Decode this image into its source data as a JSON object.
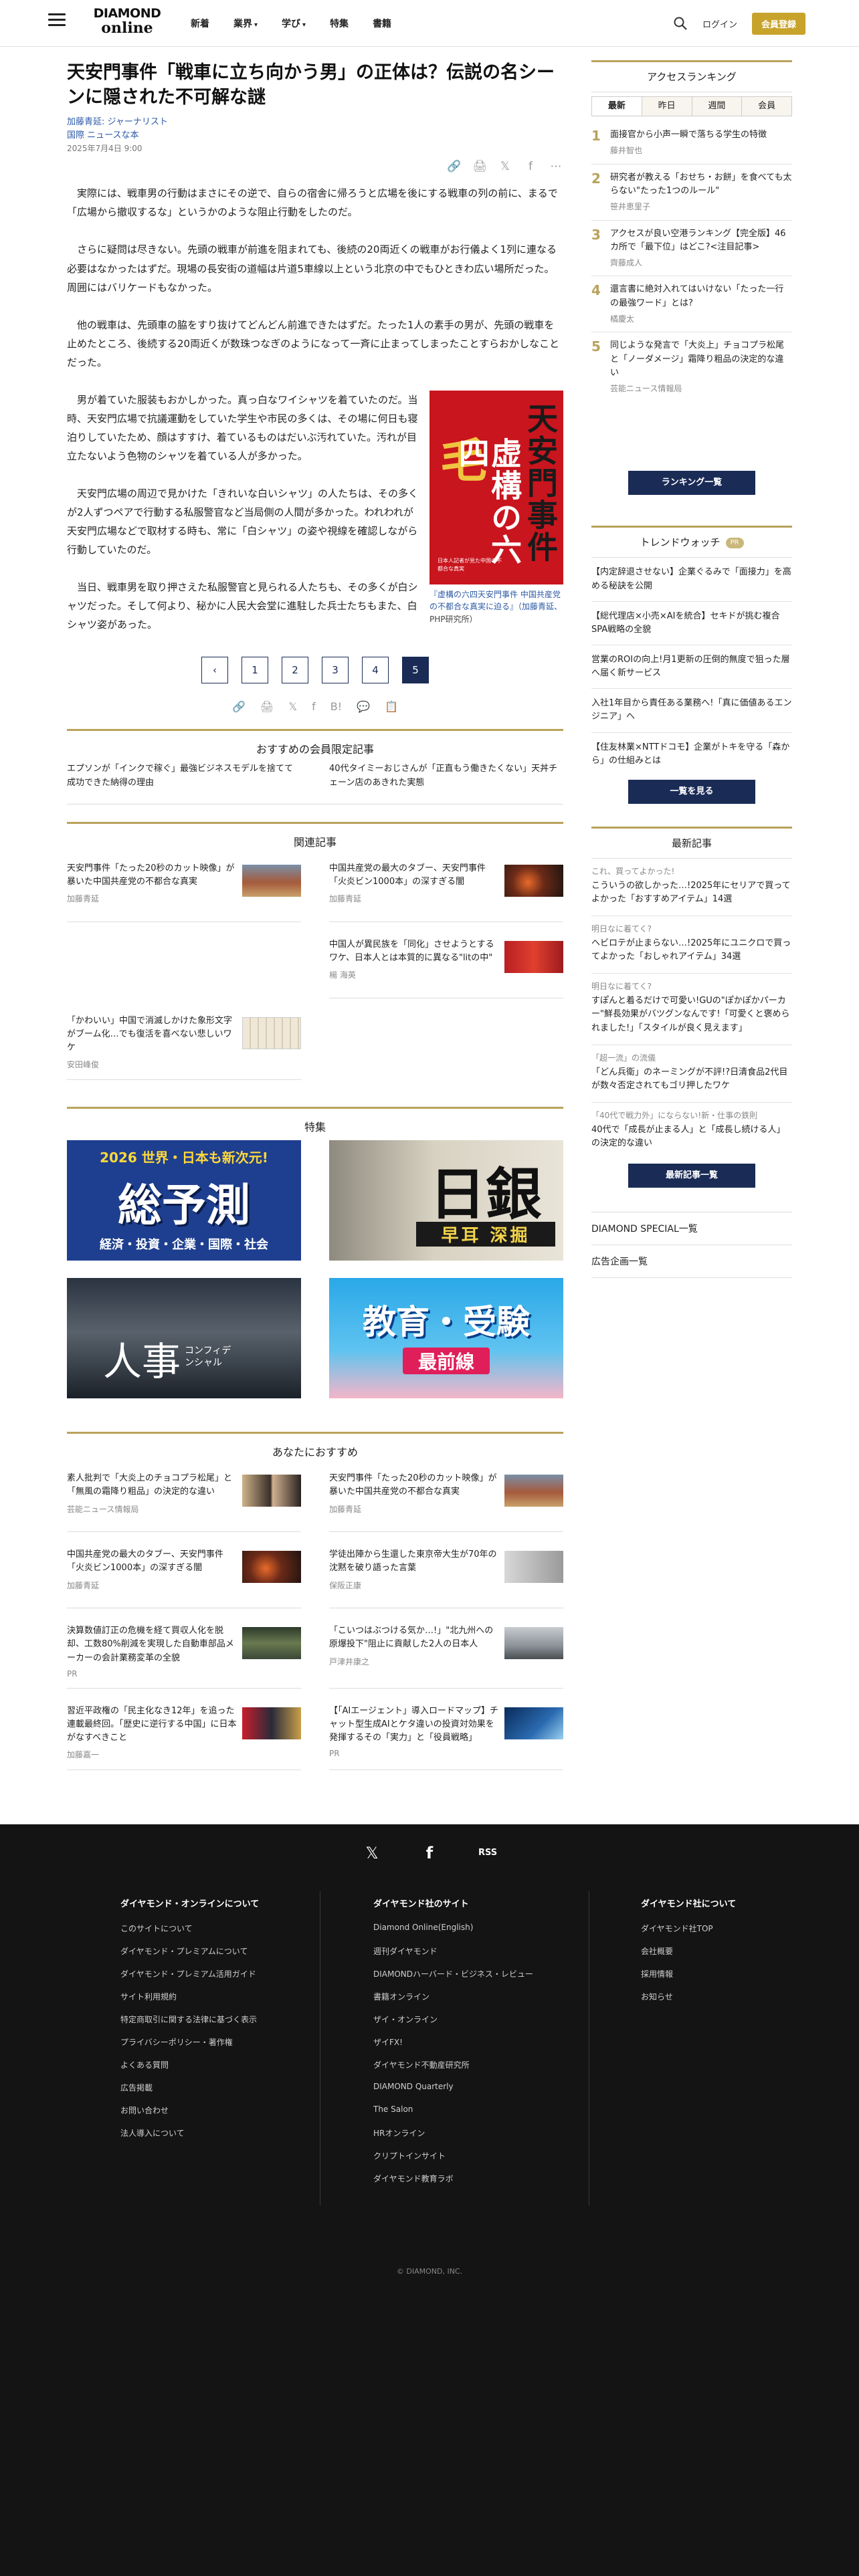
{
  "header": {
    "logo_top": "DIAMOND",
    "logo_bottom": "online",
    "nav": [
      {
        "label": "新着",
        "caret": ""
      },
      {
        "label": "業界",
        "caret": "▾"
      },
      {
        "label": "学び",
        "caret": "▾"
      },
      {
        "label": "特集",
        "caret": ""
      },
      {
        "label": "書籍",
        "caret": ""
      }
    ],
    "login_label": "ログイン",
    "join_label": "会員登録"
  },
  "article": {
    "title": "天安門事件「戦車に立ち向かう男」の正体は？伝説の名シーンに隠された不可解な謎",
    "author": "加藤青延: ジャーナリスト",
    "category": "国際 ニュースな本",
    "date": "2025年7月4日 9:00",
    "paragraphs": [
      "実際には、戦車男の行動はまさにその逆で、自らの宿舎に帰ろうと広場を後にする戦車の列の前に、まるで「広場から撤収するな」というかのような阻止行動をしたのだ。",
      "さらに疑問は尽きない。先頭の戦車が前進を阻まれても、後続の20両近くの戦車がお行儀よく1列に連なる必要はなかったはずだ。現場の長安街の道幅は片道5車線以上という北京の中でもひときわ広い場所だった。周囲にはバリケードもなかった。",
      "他の戦車は、先頭車の脇をすり抜けてどんどん前進できたはずだ。たった1人の素手の男が、先頭の戦車を止めたところ、後続する20両近くが数珠つなぎのようになって一斉に止まってしまったことすらおかしなことだった。",
      "男が着ていた服装もおかしかった。真っ白なワイシャツを着ていたのだ。当時、天安門広場で抗議運動をしていた学生や市民の多くは、その場に何日も寝泊りしていたため、顔はすすけ、着ているものはだいぶ汚れていた。汚れが目立たないよう色物のシャツを着ている人が多かった。",
      "天安門広場の周辺で見かけた「きれいな白いシャツ」の人たちは、その多くが2人ずつペアで行動する私服警官など当局側の人間が多かった。われわれが天安門広場などで取材する時も、常に「白シャツ」の姿や視線を確認しながら行動していたのだ。",
      "当日、戦車男を取り押さえた私服警官と見られる人たちも、その多くが白シャツだった。そして何より、秘かに人民大会堂に進駐した兵士たちもまた、白シャツ姿があった。"
    ],
    "book": {
      "title_right": "天安門事件",
      "title_left": "虚構の六四",
      "cover_char": "毛",
      "cover_sub": "日本人記者が見た中国の不都合な真実",
      "caption_title": "『虚構の六四天安門事件 中国共産党の不都合な真実に迫る』（加藤青延、",
      "caption_publisher": "PHP研究所）"
    },
    "pagination": {
      "prev": "‹",
      "pages": [
        "1",
        "2",
        "3",
        "4",
        "5"
      ],
      "current": "5"
    },
    "share_icons": [
      "🔗",
      "🖨",
      "𝕏",
      "f",
      "⋯"
    ],
    "share_icons_bottom": [
      "🔗",
      "🖨",
      "𝕏",
      "f",
      "B!",
      "💬",
      "📋"
    ]
  },
  "members_section": {
    "heading": "おすすめの会員限定記事",
    "items": [
      "エプソンが「インクで稼ぐ」最強ビジネスモデルを捨てて成功できた納得の理由",
      "40代タイミーおじさんが「正直もう働きたくない」天丼チェーン店のあきれた実態"
    ]
  },
  "related_section": {
    "heading": "関連記事",
    "items": [
      {
        "title": "天安門事件「たった20秒のカット映像」が暴いた中国共産党の不都合な真実",
        "author": "加藤青延"
      },
      {
        "title": "中国共産党の最大のタブー、天安門事件「火炎ビン1000本」の深すぎる闇",
        "author": "加藤青延"
      },
      {
        "title": "",
        "author": ""
      },
      {
        "title": "中国人が異民族を「同化」させようとするワケ、日本人とは本質的に異なる\"litの中\"",
        "author": "楊 海英"
      },
      {
        "title": "「かわいい」中国で消滅しかけた象形文字がブーム化…でも復活を喜べない悲しいワケ",
        "author": "安田峰俊"
      }
    ]
  },
  "feature_section": {
    "heading": "特集",
    "banners": [
      {
        "top": "2026 世界・日本も新次元!",
        "main": "総予測",
        "sub": "経済・投資・企業・国際・社会"
      },
      {
        "top": "",
        "main": "日銀",
        "sub": "早耳 深掘"
      },
      {
        "top": "",
        "main": "人事",
        "sub": "コンフィデンシャル"
      },
      {
        "top": "",
        "main": "教育・受験",
        "sub": "最前線"
      }
    ]
  },
  "recommend_section": {
    "heading": "あなたにおすすめ",
    "items": [
      {
        "title": "素人批判で「大炎上のチョコプラ松尾」と「無風の霜降り粗品」の決定的な違い",
        "author": "芸能ニュース情報局"
      },
      {
        "title": "天安門事件「たった20秒のカット映像」が暴いた中国共産党の不都合な真実",
        "author": "加藤青延"
      },
      {
        "title": "中国共産党の最大のタブー、天安門事件「火炎ビン1000本」の深すぎる闇",
        "author": "加藤青延"
      },
      {
        "title": "学徒出陣から生還した東京帝大生が70年の沈黙を破り語った言葉",
        "author": "保阪正康"
      },
      {
        "title": "決算数値訂正の危機を経て買収人化を脱却、工数80%削減を実現した自動車部品メーカーの会計業務変革の全貌",
        "author": "PR"
      },
      {
        "title": "「こいつはぶつける気か…!」\"北九州への原爆投下\"阻止に貢献した2人の日本人",
        "author": "戸津井康之"
      },
      {
        "title": "習近平政権の「民主化なき12年」を追った連載最終回。「歴史に逆行する中国」に日本がなすべきこと",
        "author": "加藤嘉一"
      },
      {
        "title": "【「AIエージェント」導入ロードマップ】チャット型生成AIとケタ違いの投資対効果を発揮するその「実力」と「役員戦略」",
        "author": "PR"
      }
    ]
  },
  "sidebar": {
    "ranking_heading": "アクセスランキング",
    "ranking_tabs": [
      "最新",
      "昨日",
      "週間",
      "会員"
    ],
    "ranking_active": "最新",
    "ranking": [
      {
        "num": "1",
        "title": "面接官から小声一瞬で落ちる学生の特徴",
        "author": "藤井智也"
      },
      {
        "num": "2",
        "title": "研究者が教える「おせち・お餅」を食べても太らない\"たった1つのルール\"",
        "author": "笹井恵里子"
      },
      {
        "num": "3",
        "title": "アクセスが良い空港ランキング【完全版】46カ所で「最下位」はどこ?<注目記事>",
        "author": "齊藤成人"
      },
      {
        "num": "4",
        "title": "還言書に絶対入れてはいけない「たった一行の最強ワード」とは?",
        "author": "橘慶太"
      },
      {
        "num": "5",
        "title": "同じような発言で「大炎上」チョコプラ松尾と「ノーダメージ」霜降り粗品の決定的な違い",
        "author": "芸能ニュース情報局"
      }
    ],
    "ranking_button": "ランキング一覧",
    "trend_heading": "トレンドウォッチ",
    "trend_badge": "PR",
    "trend": [
      "【内定辞退させない】企業ぐるみで「面接力」を高める秘訣を公開",
      "【総代理店×小売×AIを統合】セキドが挑む複合SPA戦略の全貌",
      "営業のROIの向上!月1更新の圧倒的無度で狙った層へ届く新サービス",
      "入社1年目から責任ある業務へ!「真に価値あるエンジニア」へ",
      "【住友林業×NTTドコモ】企業がトキを守る「森から」の仕組みとは"
    ],
    "trend_button": "一覧を見る",
    "latest_heading": "最新記事",
    "latest": [
      {
        "series": "これ、買ってよかった!",
        "title": "こういうの欲しかった…!2025年にセリアで買ってよかった「おすすめアイテム」14選"
      },
      {
        "series": "明日なに着てく?",
        "title": "ヘビロテが止まらない…!2025年にユニクロで買ってよかった「おしゃれアイテム」34選"
      },
      {
        "series": "明日なに着てく?",
        "title": "すぽんと着るだけで可愛い!GUの\"ぽかぽかパーカー\"鮮長効果がバツグンなんです!「可愛くと褒められました!」「スタイルが良く見えます」"
      },
      {
        "series": "「超一流」の流儀",
        "title": "「どん兵衛」のネーミングが不評!?日清食品2代目が数々否定されてもゴリ押したワケ"
      },
      {
        "series": "「40代で戦力外」にならない!新・仕事の鉄則",
        "title": "40代で「成長が止まる人」と「成長し続ける人」の決定的な違い"
      }
    ],
    "latest_button": "最新記事一覧",
    "links": [
      "DIAMOND SPECIAL一覧",
      "広告企画一覧"
    ]
  },
  "footer": {
    "social": [
      "𝕏",
      "f",
      "RSS"
    ],
    "col1_head": "ダイヤモンド・オンラインについて",
    "col1": [
      "このサイトについて",
      "ダイヤモンド・プレミアムについて",
      "ダイヤモンド・プレミアム活用ガイド",
      "サイト利用規約",
      "特定商取引に関する法律に基づく表示",
      "プライバシーポリシー・著作権",
      "よくある質問",
      "広告掲載",
      "お問い合わせ",
      "法人導入について"
    ],
    "col2_head": "ダイヤモンド社のサイト",
    "col2": [
      "Diamond Online(English)",
      "週刊ダイヤモンド",
      "DIAMONDハーバード・ビジネス・レビュー",
      "書籍オンライン",
      "ザイ・オンライン",
      "ザイFX!",
      "ダイヤモンド不動産研究所",
      "DIAMOND Quarterly",
      "The Salon",
      "HRオンライン",
      "クリプトインサイト",
      "ダイヤモンド教育ラボ"
    ],
    "col3_head": "ダイヤモンド社について",
    "col3": [
      "ダイヤモンド社TOP",
      "会社概要",
      "採用情報",
      "お知らせ"
    ],
    "copyright": "© DIAMOND, INC."
  }
}
